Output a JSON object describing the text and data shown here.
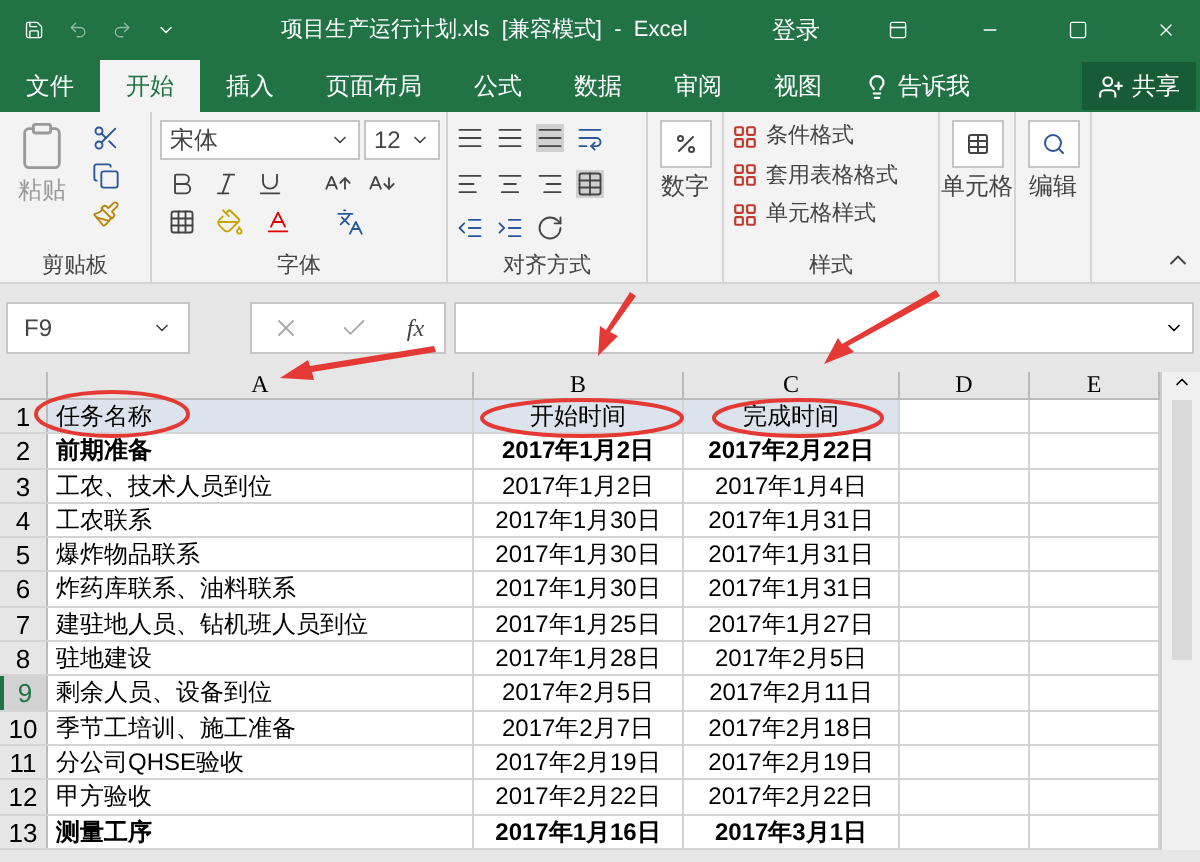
{
  "window": {
    "title": "项目生产运行计划.xls  [兼容模式]  -  Excel",
    "signin": "登录"
  },
  "tabs": [
    {
      "label": "文件",
      "selected": false
    },
    {
      "label": "开始",
      "selected": true
    },
    {
      "label": "插入",
      "selected": false
    },
    {
      "label": "页面布局",
      "selected": false
    },
    {
      "label": "公式",
      "selected": false
    },
    {
      "label": "数据",
      "selected": false
    },
    {
      "label": "审阅",
      "selected": false
    },
    {
      "label": "视图",
      "selected": false
    }
  ],
  "tell_me": "告诉我",
  "share": "共享",
  "ribbon": {
    "clipboard": {
      "paste": "粘贴",
      "label": "剪贴板"
    },
    "font": {
      "name": "宋体",
      "size": "12",
      "label": "字体"
    },
    "alignment": {
      "label": "对齐方式"
    },
    "number": {
      "button": "数字"
    },
    "styles": {
      "items": [
        "条件格式",
        "套用表格格式",
        "单元格样式"
      ],
      "label": "样式"
    },
    "cells": "单元格",
    "editing": "编辑"
  },
  "formula_bar": {
    "name_box": "F9",
    "fx": "fx"
  },
  "sheet": {
    "columns": [
      "A",
      "B",
      "C",
      "D",
      "E"
    ],
    "rows": [
      {
        "number": "1",
        "kind": "header",
        "bold": false,
        "selected": false,
        "cells": [
          "任务名称",
          "开始时间",
          "完成时间"
        ]
      },
      {
        "number": "2",
        "kind": "data",
        "bold": true,
        "selected": false,
        "cells": [
          "前期准备",
          "2017年1月2日",
          "2017年2月22日"
        ]
      },
      {
        "number": "3",
        "kind": "data",
        "bold": false,
        "selected": false,
        "cells": [
          "工农、技术人员到位",
          "2017年1月2日",
          "2017年1月4日"
        ]
      },
      {
        "number": "4",
        "kind": "data",
        "bold": false,
        "selected": false,
        "cells": [
          "工农联系",
          "2017年1月30日",
          "2017年1月31日"
        ]
      },
      {
        "number": "5",
        "kind": "data",
        "bold": false,
        "selected": false,
        "cells": [
          "爆炸物品联系",
          "2017年1月30日",
          "2017年1月31日"
        ]
      },
      {
        "number": "6",
        "kind": "data",
        "bold": false,
        "selected": false,
        "cells": [
          "炸药库联系、油料联系",
          "2017年1月30日",
          "2017年1月31日"
        ]
      },
      {
        "number": "7",
        "kind": "data",
        "bold": false,
        "selected": false,
        "cells": [
          "建驻地人员、钻机班人员到位",
          "2017年1月25日",
          "2017年1月27日"
        ]
      },
      {
        "number": "8",
        "kind": "data",
        "bold": false,
        "selected": false,
        "cells": [
          "驻地建设",
          "2017年1月28日",
          "2017年2月5日"
        ]
      },
      {
        "number": "9",
        "kind": "data",
        "bold": false,
        "selected": true,
        "cells": [
          "剩余人员、设备到位",
          "2017年2月5日",
          "2017年2月11日"
        ]
      },
      {
        "number": "10",
        "kind": "data",
        "bold": false,
        "selected": false,
        "cells": [
          "季节工培训、施工准备",
          "2017年2月7日",
          "2017年2月18日"
        ]
      },
      {
        "number": "11",
        "kind": "data",
        "bold": false,
        "selected": false,
        "cells": [
          "分公司QHSE验收",
          "2017年2月19日",
          "2017年2月19日"
        ]
      },
      {
        "number": "12",
        "kind": "data",
        "bold": false,
        "selected": false,
        "cells": [
          "甲方验收",
          "2017年2月22日",
          "2017年2月22日"
        ]
      },
      {
        "number": "13",
        "kind": "data",
        "bold": true,
        "selected": false,
        "cells": [
          "测量工序",
          "2017年1月16日",
          "2017年3月1日"
        ]
      }
    ]
  }
}
